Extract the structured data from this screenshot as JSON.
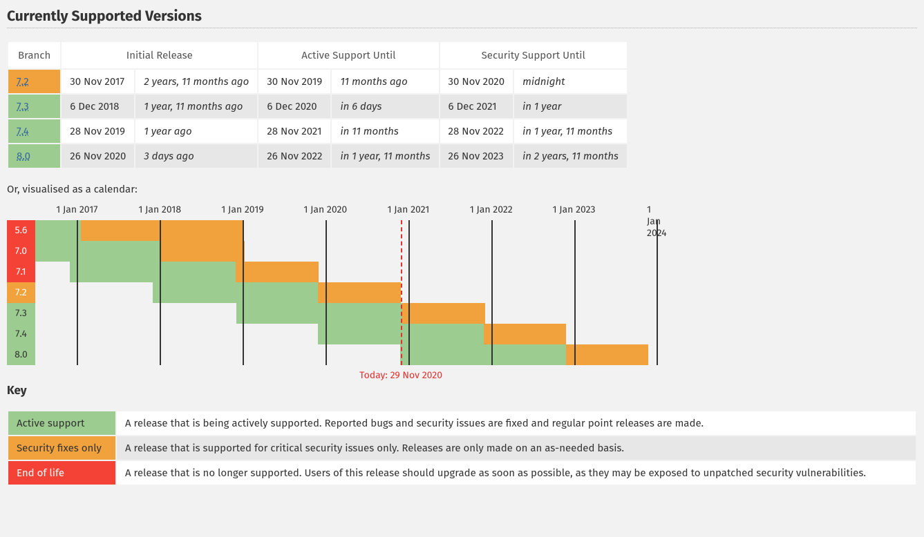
{
  "title": "Currently Supported Versions",
  "headers": {
    "branch": "Branch",
    "initial": "Initial Release",
    "active": "Active Support Until",
    "security": "Security Support Until"
  },
  "rows": [
    {
      "branch": "7.2",
      "status": "sec",
      "released": "30 Nov 2017",
      "released_rel": "2 years, 11 months ago",
      "active_until": "30 Nov 2019",
      "active_rel": "11 months ago",
      "security_until": "30 Nov 2020",
      "security_rel": "midnight"
    },
    {
      "branch": "7.3",
      "status": "active",
      "released": "6 Dec 2018",
      "released_rel": "1 year, 11 months ago",
      "active_until": "6 Dec 2020",
      "active_rel": "in 6 days",
      "security_until": "6 Dec 2021",
      "security_rel": "in 1 year"
    },
    {
      "branch": "7.4",
      "status": "active",
      "released": "28 Nov 2019",
      "released_rel": "1 year ago",
      "active_until": "28 Nov 2021",
      "active_rel": "in 11 months",
      "security_until": "28 Nov 2022",
      "security_rel": "in 1 year, 11 months"
    },
    {
      "branch": "8.0",
      "status": "active",
      "released": "26 Nov 2020",
      "released_rel": "3 days ago",
      "active_until": "26 Nov 2022",
      "active_rel": "in 1 year, 11 months",
      "security_until": "26 Nov 2023",
      "security_rel": "in 2 years, 11 months"
    }
  ],
  "calendar_label": "Or, visualised as a calendar:",
  "chart_data": {
    "type": "bar",
    "today": "29 Nov 2020",
    "today_label": "Today: 29 Nov 2020",
    "year_ticks": [
      "1 Jan 2017",
      "1 Jan 2018",
      "1 Jan 2019",
      "1 Jan 2020",
      "1 Jan 2021",
      "1 Jan 2022",
      "1 Jan 2023",
      "1 Jan 2024"
    ],
    "x_range": [
      "2016-07-01",
      "2024-03-01"
    ],
    "series": [
      {
        "branch": "5.6",
        "status": "eol",
        "active_start": "2016-07-01",
        "active_end": "2017-01-19",
        "security_end": "2018-12-31"
      },
      {
        "branch": "7.0",
        "status": "eol",
        "active_start": "2016-07-01",
        "active_end": "2018-01-04",
        "security_end": "2019-01-10"
      },
      {
        "branch": "7.1",
        "status": "eol",
        "active_start": "2016-12-01",
        "active_end": "2018-12-01",
        "security_end": "2019-12-01"
      },
      {
        "branch": "7.2",
        "status": "sec",
        "active_start": "2017-11-30",
        "active_end": "2019-11-30",
        "security_end": "2020-11-30"
      },
      {
        "branch": "7.3",
        "status": "active",
        "active_start": "2018-12-06",
        "active_end": "2020-12-06",
        "security_end": "2021-12-06"
      },
      {
        "branch": "7.4",
        "status": "active",
        "active_start": "2019-11-28",
        "active_end": "2021-11-28",
        "security_end": "2022-11-28"
      },
      {
        "branch": "8.0",
        "status": "active",
        "active_start": "2020-11-26",
        "active_end": "2022-11-26",
        "security_end": "2023-11-26"
      }
    ]
  },
  "key": {
    "title": "Key",
    "items": [
      {
        "label": "Active support",
        "class": "k-active",
        "desc": "A release that is being actively supported. Reported bugs and security issues are fixed and regular point releases are made."
      },
      {
        "label": "Security fixes only",
        "class": "k-sec",
        "desc": "A release that is supported for critical security issues only. Releases are only made on an as-needed basis."
      },
      {
        "label": "End of life",
        "class": "k-eol",
        "desc": "A release that is no longer supported. Users of this release should upgrade as soon as possible, as they may be exposed to unpatched security vulnerabilities."
      }
    ]
  }
}
